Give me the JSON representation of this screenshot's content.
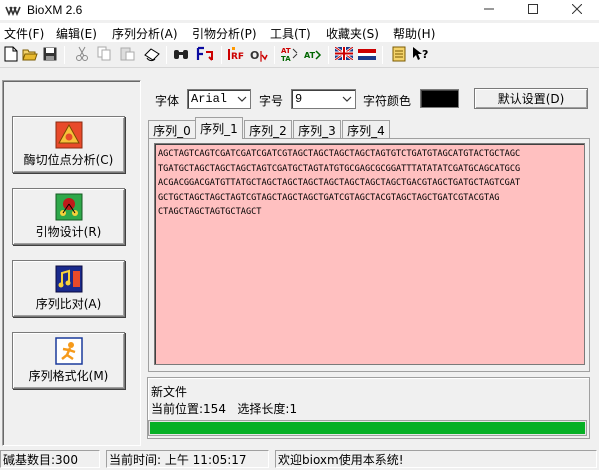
{
  "window": {
    "title": "BioXM 2.6",
    "icons": {
      "app": "bioxm-app-icon",
      "minimize": "minimize-icon",
      "maximize": "maximize-icon",
      "close": "close-icon"
    }
  },
  "menu": {
    "items": [
      "文件(F)",
      "编辑(E)",
      "序列分析(A)",
      "引物分析(P)",
      "工具(T)",
      "收藏夹(S)",
      "帮助(H)"
    ]
  },
  "toolbar": {
    "icons": [
      "new-file-icon",
      "open-folder-icon",
      "save-icon",
      "cut-icon",
      "copy-icon",
      "paste-icon",
      "rotate-icon",
      "find-icon",
      "find-next-icon",
      "orf-icon",
      "ol-icon",
      "reverse-complement-icon",
      "translate-icon",
      "uk-flag-icon",
      "flag-icon",
      "notepad-icon",
      "help-pointer-icon"
    ]
  },
  "left_panel": {
    "buttons": [
      {
        "label": "酶切位点分析(C)",
        "icon": "enzyme-site-icon"
      },
      {
        "label": "引物设计(R)",
        "icon": "primer-design-icon"
      },
      {
        "label": "序列比对(A)",
        "icon": "sequence-align-icon"
      },
      {
        "label": "序列格式化(M)",
        "icon": "sequence-format-icon"
      }
    ]
  },
  "font_controls": {
    "font_label": "字体",
    "font_value": "Arial",
    "size_label": "字号",
    "size_value": "9",
    "color_label": "字符颜色",
    "color_value": "#000000",
    "default_button": "默认设置(D)"
  },
  "tabs": [
    {
      "label": "序列_0",
      "active": false
    },
    {
      "label": "序列_1",
      "active": true
    },
    {
      "label": "序列_2",
      "active": false
    },
    {
      "label": "序列_3",
      "active": false
    },
    {
      "label": "序列_4",
      "active": false
    }
  ],
  "sequence": {
    "background": "#ffc0c0",
    "lines": [
      "AGCTAGTCAGTCGATCGATCGATCGTAGCTAGCTAGCTAGCTAGTGTCTGATGTAGCATGTACTGCTAGC",
      "TGATGCTAGCTAGCTAGCTAGTCGATGCTAGTATGTGCGAGCGCGGATTTATATATCGATGCAGCATGCG",
      "ACGACGGACGATGTTATGCTAGCTAGCTAGCTAGCTAGCTAGCTAGCTGACGTAGCTGATGCTAGTCGAT",
      "GCTGCTAGCTAGCTAGTCGTAGCTAGCTAGCTGATCGTAGCTACGTAGCTAGCTGATCGTACGTAG",
      "CTAGCTAGCTAGTGCTAGCT"
    ]
  },
  "info": {
    "file_status": "新文件",
    "position_label": "当前位置:",
    "position_value": "154",
    "selection_label": "选择长度:",
    "selection_value": "1",
    "progress_fraction": 1.0,
    "progress_color": "#06b025"
  },
  "statusbar": {
    "base_count": "碱基数目:300",
    "current_time": "当前时间: 上午 11:05:17",
    "welcome": "欢迎bioxm使用本系统!"
  }
}
